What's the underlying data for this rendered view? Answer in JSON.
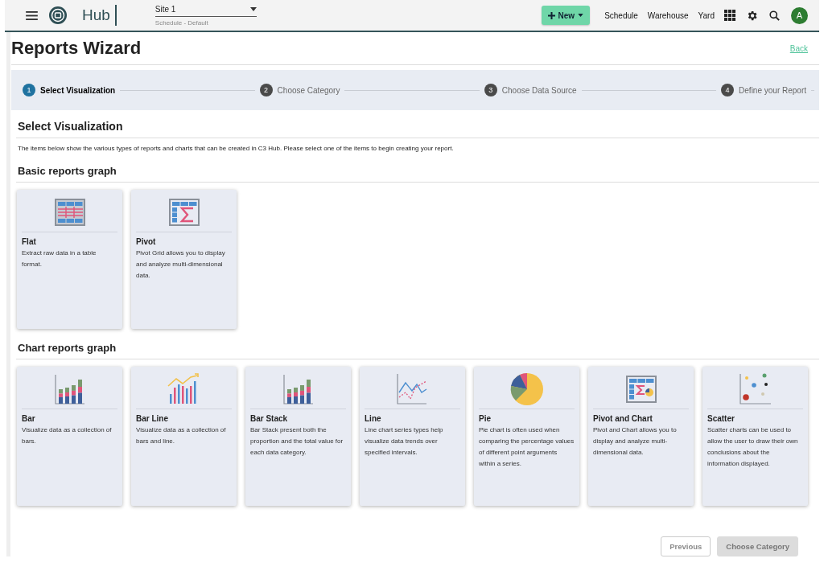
{
  "topbar": {
    "logo_text": "Hub",
    "site": {
      "value": "Site 1",
      "helper": "Schedule - Default"
    },
    "new_button": "New",
    "nav_links": [
      "Schedule",
      "Warehouse",
      "Yard"
    ],
    "avatar": "A"
  },
  "page_title": "Reports Wizard",
  "back_link": "Back",
  "steps": [
    {
      "number": "1",
      "label": "Select Visualization",
      "selected": true
    },
    {
      "number": "2",
      "label": "Choose Category",
      "selected": false
    },
    {
      "number": "3",
      "label": "Choose Data Source",
      "selected": false
    },
    {
      "number": "4",
      "label": "Define your Report",
      "selected": false
    }
  ],
  "section": {
    "title": "Select Visualization",
    "description": "The items below show the various types of reports and charts that can be created in C3 Hub. Please select one of the items to begin creating your report."
  },
  "groups": [
    {
      "title": "Basic reports graph",
      "cards": [
        {
          "kind": "flat",
          "title": "Flat",
          "description": "Extract raw data in a table format."
        },
        {
          "kind": "pivot",
          "title": "Pivot",
          "description": "Pivot Grid allows you to display and analyze multi-dimensional data."
        }
      ]
    },
    {
      "title": "Chart reports graph",
      "cards": [
        {
          "kind": "bar",
          "title": "Bar",
          "description": "Visualize data as a collection of bars."
        },
        {
          "kind": "barline",
          "title": "Bar Line",
          "description": "Visualize data as a collection of bars and line."
        },
        {
          "kind": "barstack",
          "title": "Bar Stack",
          "description": "Bar Stack present both the proportion and the total value for each data category."
        },
        {
          "kind": "line",
          "title": "Line",
          "description": "Line chart series types help visualize data trends over specified intervals."
        },
        {
          "kind": "pie",
          "title": "Pie",
          "description": "Pie chart is often used when comparing the percentage values of different point arguments within a series."
        },
        {
          "kind": "pivotchart",
          "title": "Pivot and Chart",
          "description": "Pivot and Chart allows you to display and analyze multi-dimensional data."
        },
        {
          "kind": "scatter",
          "title": "Scatter",
          "description": "Scatter charts can be used to allow the user to draw their own conclusions about the information displayed."
        }
      ]
    }
  ],
  "buttons": [
    {
      "label": "Previous",
      "kind": "outline",
      "disabled": true
    },
    {
      "label": "Choose Category",
      "kind": "filled",
      "disabled": true
    }
  ]
}
